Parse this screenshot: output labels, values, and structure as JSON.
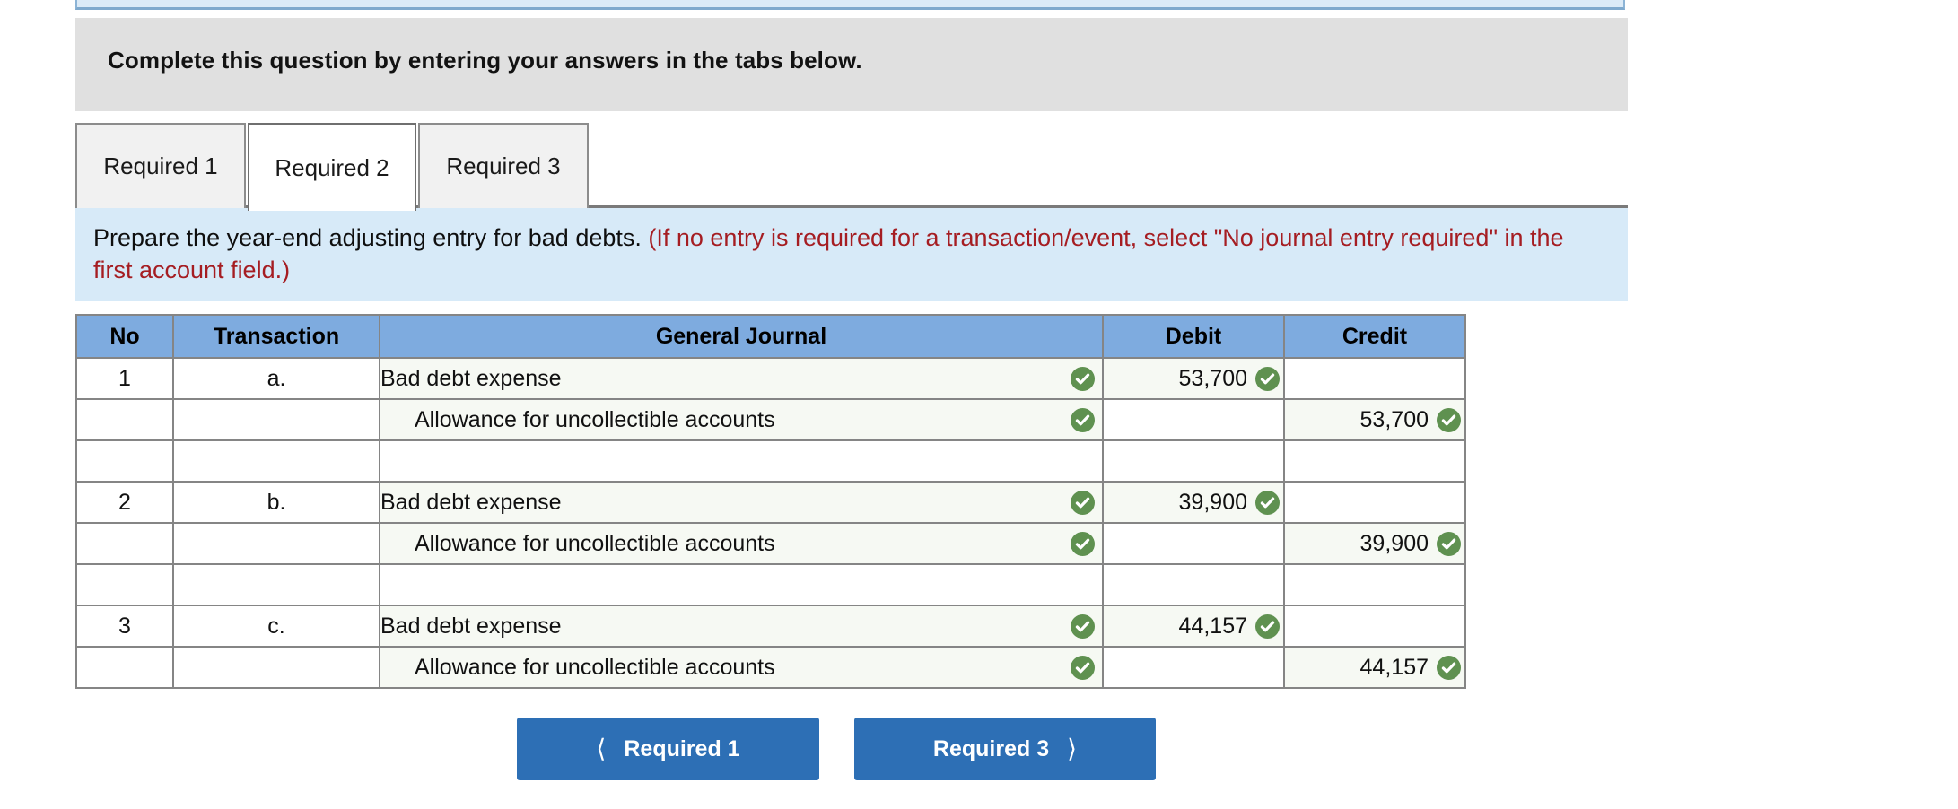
{
  "banner": {
    "text": "Complete this question by entering your answers in the tabs below."
  },
  "tabs": [
    {
      "label": "Required 1",
      "active": false
    },
    {
      "label": "Required 2",
      "active": true
    },
    {
      "label": "Required 3",
      "active": false
    }
  ],
  "prompt": {
    "main": "Prepare the year-end adjusting entry for bad debts.",
    "note": "(If no entry is required for a transaction/event, select \"No journal entry required\" in the first account field.)"
  },
  "table": {
    "headers": [
      "No",
      "Transaction",
      "General Journal",
      "Debit",
      "Credit"
    ],
    "rows": [
      {
        "no": "1",
        "transaction": "a.",
        "journal": "Bad debt expense",
        "indent": false,
        "journal_check": true,
        "debit": "53,700",
        "debit_check": true,
        "credit": "",
        "credit_check": false
      },
      {
        "no": "",
        "transaction": "",
        "journal": "Allowance for uncollectible accounts",
        "indent": true,
        "journal_check": true,
        "debit": "",
        "debit_check": false,
        "credit": "53,700",
        "credit_check": true
      },
      {
        "no": "",
        "transaction": "",
        "journal": "",
        "indent": false,
        "journal_check": false,
        "debit": "",
        "debit_check": false,
        "credit": "",
        "credit_check": false
      },
      {
        "no": "2",
        "transaction": "b.",
        "journal": "Bad debt expense",
        "indent": false,
        "journal_check": true,
        "debit": "39,900",
        "debit_check": true,
        "credit": "",
        "credit_check": false
      },
      {
        "no": "",
        "transaction": "",
        "journal": "Allowance for uncollectible accounts",
        "indent": true,
        "journal_check": true,
        "debit": "",
        "debit_check": false,
        "credit": "39,900",
        "credit_check": true
      },
      {
        "no": "",
        "transaction": "",
        "journal": "",
        "indent": false,
        "journal_check": false,
        "debit": "",
        "debit_check": false,
        "credit": "",
        "credit_check": false
      },
      {
        "no": "3",
        "transaction": "c.",
        "journal": "Bad debt expense",
        "indent": false,
        "journal_check": true,
        "debit": "44,157",
        "debit_check": true,
        "credit": "",
        "credit_check": false
      },
      {
        "no": "",
        "transaction": "",
        "journal": "Allowance for uncollectible accounts",
        "indent": true,
        "journal_check": true,
        "debit": "",
        "debit_check": false,
        "credit": "44,157",
        "credit_check": true
      }
    ]
  },
  "nav": {
    "prev_label": "Required 1",
    "next_label": "Required 3",
    "prev_icon": "chevron-left-icon",
    "next_icon": "chevron-right-icon"
  },
  "colors": {
    "header_blue": "#7eabdf",
    "prompt_blue": "#d7eaf8",
    "banner_grey": "#e0e0e0",
    "note_red": "#a51d22",
    "button_blue": "#2d6fb5",
    "check_green": "#5f9150",
    "filled_cell": "#f6f9f3"
  }
}
